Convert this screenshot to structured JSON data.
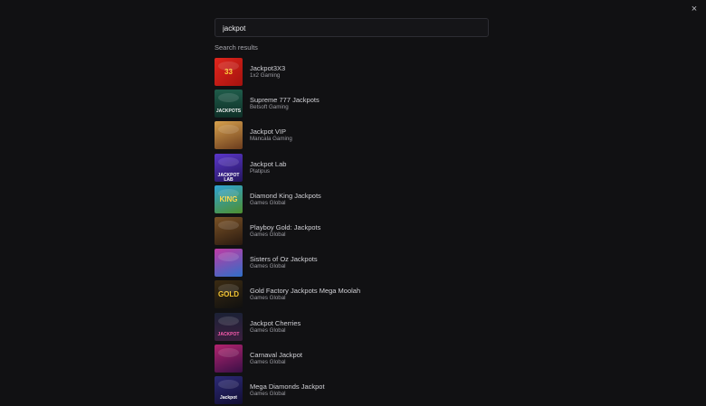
{
  "search": {
    "value": "jackpot",
    "placeholder": ""
  },
  "close_label": "×",
  "results_heading": "Search results",
  "results": [
    {
      "title": "Jackpot3X3",
      "provider": "1x2 Gaming",
      "thumb_text": "33",
      "bg": "linear-gradient(135deg,#e0261d,#a3120e)",
      "fg": "#ffd23c"
    },
    {
      "title": "Supreme 777 Jackpots",
      "provider": "Betsoft Gaming",
      "thumb_text": "JACKPOTS",
      "bg": "linear-gradient(180deg,#1f5c4a,#0e2f27)",
      "fg": "#f2f2f2"
    },
    {
      "title": "Jackpot VIP",
      "provider": "Mancala Gaming",
      "thumb_text": "",
      "bg": "linear-gradient(160deg,#d7a14d,#6b3c1d)",
      "fg": "#fff"
    },
    {
      "title": "Jackpot Lab",
      "provider": "Platipus",
      "thumb_text": "JACKPOT LAB",
      "bg": "linear-gradient(160deg,#5a36c9,#24165e)",
      "fg": "#ffffff"
    },
    {
      "title": "Diamond King Jackpots",
      "provider": "Games Global",
      "thumb_text": "KING",
      "bg": "linear-gradient(160deg,#2fa3d4,#4e8f2f)",
      "fg": "#ffd84a"
    },
    {
      "title": "Playboy Gold: Jackpots",
      "provider": "Games Global",
      "thumb_text": "",
      "bg": "linear-gradient(160deg,#7a5226,#2a1a10)",
      "fg": "#fff"
    },
    {
      "title": "Sisters of Oz Jackpots",
      "provider": "Games Global",
      "thumb_text": "",
      "bg": "linear-gradient(160deg,#c03aa4,#2f6fc8)",
      "fg": "#fff"
    },
    {
      "title": "Gold Factory Jackpots Mega Moolah",
      "provider": "Games Global",
      "thumb_text": "GOLD",
      "bg": "linear-gradient(160deg,#3b2b12,#101010)",
      "fg": "#f3c431"
    },
    {
      "title": "Jackpot Cherries",
      "provider": "Games Global",
      "thumb_text": "JACKPOT",
      "bg": "linear-gradient(180deg,#1b2136,#3b1f3e)",
      "fg": "#ff5db0"
    },
    {
      "title": "Carnaval Jackpot",
      "provider": "Games Global",
      "thumb_text": "",
      "bg": "linear-gradient(160deg,#b2246e,#3a0f47)",
      "fg": "#ffd24a"
    },
    {
      "title": "Mega Diamonds Jackpot",
      "provider": "Games Global",
      "thumb_text": "Jackpot",
      "bg": "linear-gradient(160deg,#2c2a76,#120e33)",
      "fg": "#ffffff"
    }
  ]
}
